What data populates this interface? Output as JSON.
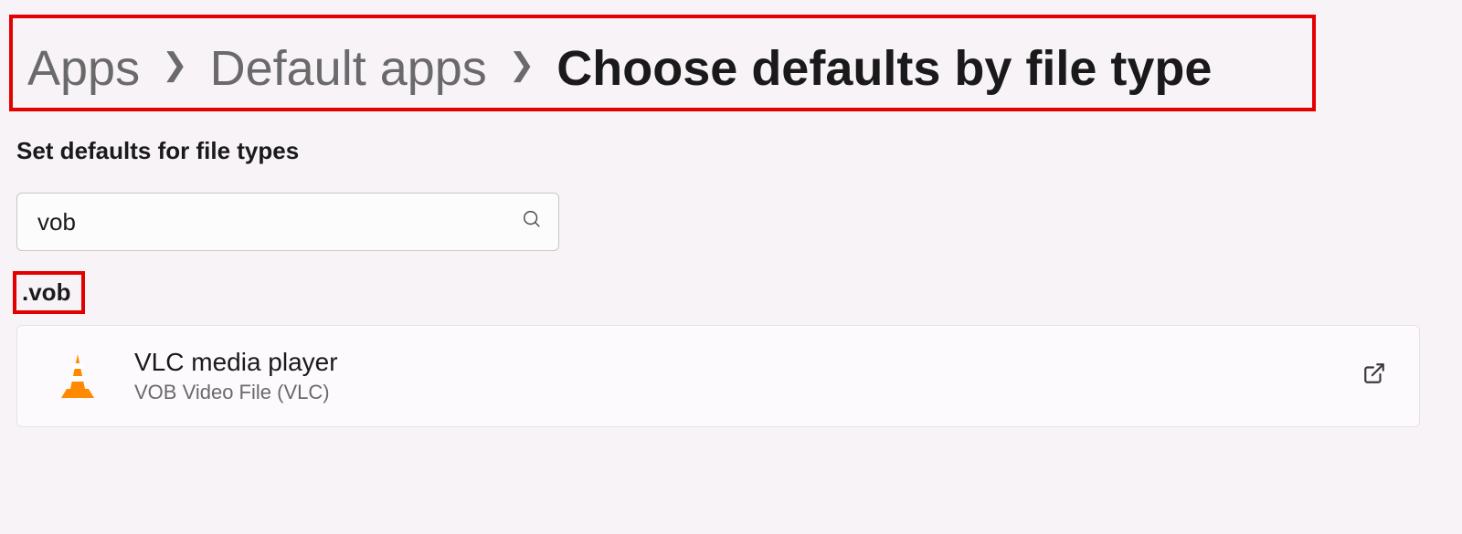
{
  "breadcrumb": {
    "items": [
      {
        "label": "Apps"
      },
      {
        "label": "Default apps"
      }
    ],
    "current": "Choose defaults by file type"
  },
  "section_title": "Set defaults for file types",
  "search": {
    "value": "vob"
  },
  "extension_label": ".vob",
  "app": {
    "name": "VLC media player",
    "description": "VOB Video File (VLC)",
    "icon": "vlc-cone-icon"
  }
}
